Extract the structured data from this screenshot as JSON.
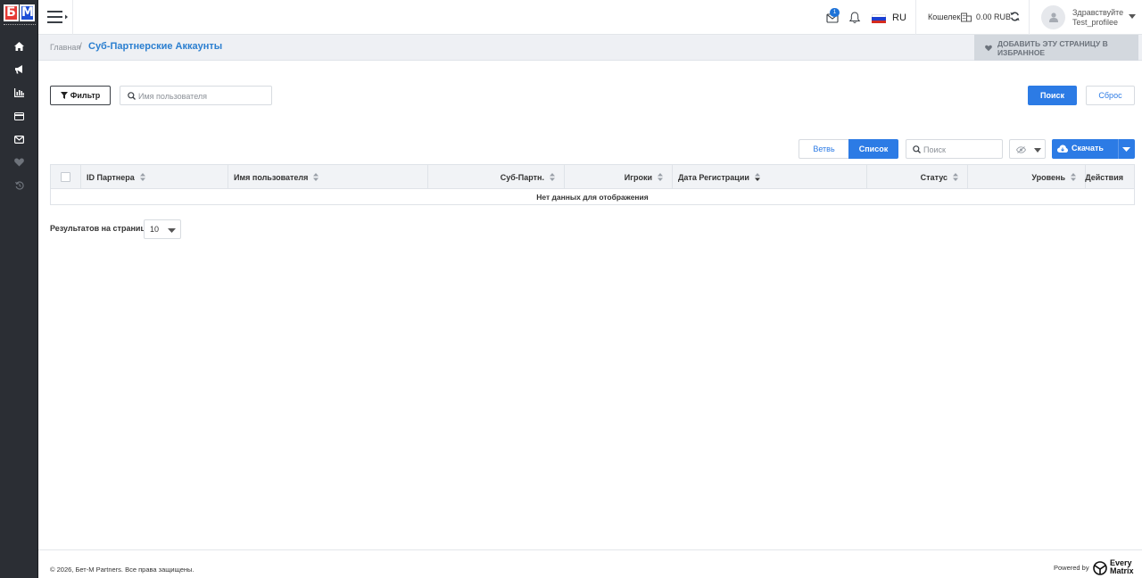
{
  "brand": {
    "logo_left": "Б",
    "logo_right": "М"
  },
  "colors": {
    "accent": "#2c7be5",
    "sidebar": "#2b2e34",
    "logo_red": "#e53935",
    "logo_blue": "#1e4fd6"
  },
  "sidebar": {
    "items": [
      {
        "icon": "home-icon"
      },
      {
        "icon": "megaphone-icon"
      },
      {
        "icon": "bar-chart-icon"
      },
      {
        "icon": "credit-card-icon"
      },
      {
        "icon": "envelope-icon"
      },
      {
        "icon": "heart-icon"
      },
      {
        "icon": "history-icon"
      }
    ]
  },
  "header": {
    "mail_badge": "1",
    "language": "RU",
    "wallet_label": "Кошелек",
    "balance": "0.00 RUB",
    "greeting": "Здравствуйте",
    "username": "Test_profilee"
  },
  "breadcrumb": {
    "home": "Главная",
    "separator": "/",
    "current": "Суб-Партнерские Аккаунты",
    "favorite": "ДОБАВИТЬ ЭТУ СТРАНИЦУ В ИЗБРАННОЕ"
  },
  "filters": {
    "filter_label": "Фильтр",
    "username_placeholder": "Имя пользователя",
    "search_label": "Поиск",
    "reset_label": "Сброс"
  },
  "toolbar": {
    "branch_label": "Ветвь",
    "list_label": "Список",
    "search_placeholder": "Поиск",
    "download_label": "Скачать"
  },
  "table": {
    "columns": [
      "ID Партнера",
      "Имя пользователя",
      "Суб-Партн.",
      "Игроки",
      "Дата Регистрации",
      "Статус",
      "Уровень",
      "Действия"
    ],
    "empty_message": "Нет данных для отображения"
  },
  "pagination": {
    "per_page_label": "Результатов на странице",
    "per_page_value": "10"
  },
  "footer": {
    "copyright": "© 2026, Бет-М Partners. Все права защищены.",
    "powered_by": "Powered by",
    "vendor_line1": "Every",
    "vendor_line2": "Matrix"
  }
}
